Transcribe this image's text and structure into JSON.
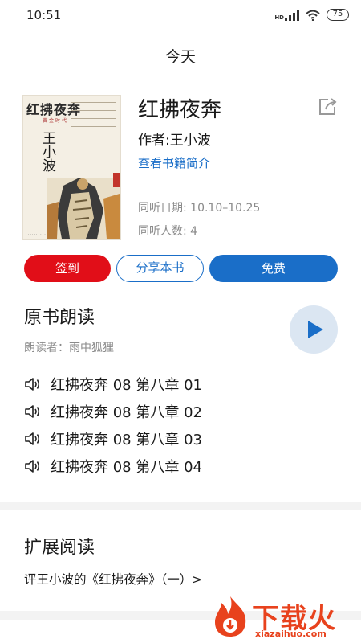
{
  "status_bar": {
    "time": "10:51",
    "network": "HD",
    "battery": "75"
  },
  "page": {
    "title": "今天"
  },
  "book": {
    "cover": {
      "title": "红拂夜奔",
      "subtitle": "黄金时代",
      "author": "王小波"
    },
    "title": "红拂夜奔",
    "author": "作者:王小波",
    "intro_link": "查看书籍简介",
    "listen_date": "同听日期: 10.10–10.25",
    "listen_count": "同听人数: 4"
  },
  "actions": {
    "sign_in": "签到",
    "share": "分享本书",
    "free": "免费"
  },
  "reading": {
    "title": "原书朗读",
    "reader": "朗读者：雨中狐狸",
    "chapters": [
      "红拂夜奔 08 第八章 01",
      "红拂夜奔 08 第八章 02",
      "红拂夜奔 08 第八章 03",
      "红拂夜奔 08 第八章 04"
    ]
  },
  "extended": {
    "title": "扩展阅读",
    "article": "评王小波的《红拂夜奔》（一）>"
  },
  "watermark": {
    "text": "下载火",
    "url": "xiazaihuo.com"
  },
  "colors": {
    "accent_blue": "#1a6ec8",
    "accent_red": "#e10e18",
    "play_bg": "#dbe6f2",
    "watermark": "#e8421d"
  },
  "icons": [
    "signal-icon",
    "wifi-icon",
    "battery-icon",
    "share-icon",
    "play-icon",
    "speaker-icon"
  ]
}
